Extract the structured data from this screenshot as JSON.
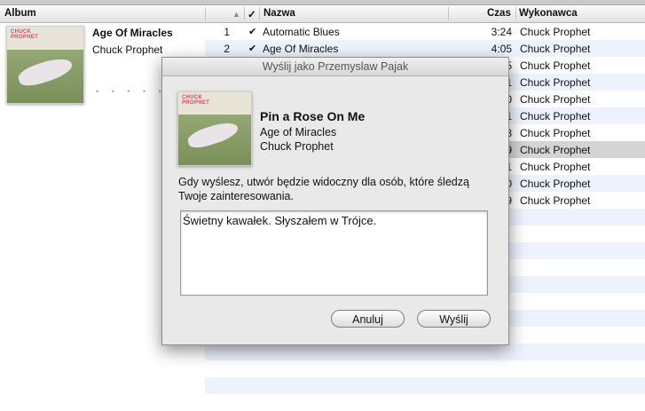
{
  "columns": {
    "album": "Album",
    "name": "Nazwa",
    "time": "Czas",
    "artist": "Wykonawca",
    "sort_arrow": "▲",
    "check": "✓"
  },
  "album_info": {
    "title": "Age Of Miracles",
    "artist": "Chuck Prophet",
    "cover_text_line1": "CHUCK",
    "cover_text_line2": "PROPHET"
  },
  "tracks": [
    {
      "num": "1",
      "check": "✔",
      "name": "Automatic Blues",
      "time": "3:24",
      "artist": "Chuck Prophet"
    },
    {
      "num": "2",
      "check": "✔",
      "name": "Age Of Miracles",
      "time": "4:05",
      "artist": "Chuck Prophet"
    },
    {
      "time": "5",
      "artist": "Chuck Prophet"
    },
    {
      "time": "1",
      "artist": "Chuck Prophet"
    },
    {
      "time": "0",
      "artist": "Chuck Prophet"
    },
    {
      "time": "1",
      "artist": "Chuck Prophet"
    },
    {
      "time": "3",
      "artist": "Chuck Prophet"
    },
    {
      "time": "9",
      "artist": "Chuck Prophet",
      "selected": true
    },
    {
      "time": "1",
      "artist": "Chuck Prophet"
    },
    {
      "time": "0",
      "artist": "Chuck Prophet"
    },
    {
      "time": "9",
      "artist": "Chuck Prophet"
    }
  ],
  "dialog": {
    "title": "Wyślij jako Przemyslaw Pajak",
    "song_title": "Pin a Rose On Me",
    "song_album": "Age of Miracles",
    "song_artist": "Chuck Prophet",
    "info": "Gdy wyślesz, utwór będzie widoczny dla osób, które śledzą Twoje zainteresowania.",
    "message": "Świetny kawałek. Słyszałem w Trójce.",
    "cancel_label": "Anuluj",
    "send_label": "Wyślij"
  }
}
